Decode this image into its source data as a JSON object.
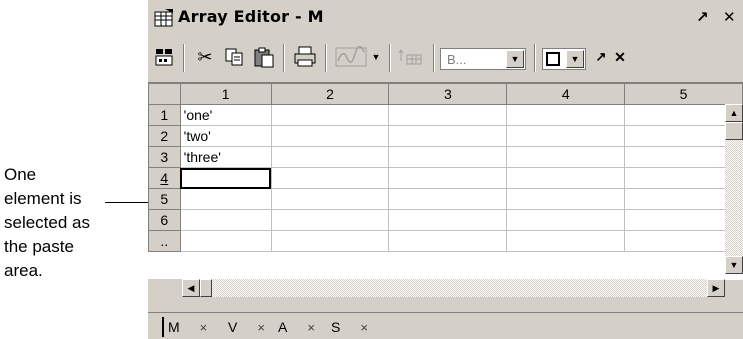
{
  "annotation": {
    "lines": [
      "One",
      "element is",
      "selected as",
      "the paste",
      "area."
    ]
  },
  "window": {
    "title": "Array Editor - M",
    "undock_label": "↗",
    "close_label": "✕"
  },
  "toolbar": {
    "icons": [
      "import-data-icon",
      "cut-icon",
      "copy-icon",
      "paste-icon",
      "print-icon",
      "plot-icon",
      "stack-icon"
    ],
    "base_combo_text": "B...",
    "layout_close": "✕",
    "layout_undock": "↗"
  },
  "grid": {
    "column_headers": [
      "1",
      "2",
      "3",
      "4",
      "5"
    ],
    "row_headers": [
      "1",
      "2",
      "3",
      "4",
      "5",
      "6",
      ".."
    ],
    "cells": [
      [
        "'one'",
        "",
        "",
        "",
        ""
      ],
      [
        "'two'",
        "",
        "",
        "",
        ""
      ],
      [
        "'three'",
        "",
        "",
        "",
        ""
      ],
      [
        "",
        "",
        "",
        "",
        ""
      ],
      [
        "",
        "",
        "",
        "",
        ""
      ],
      [
        "",
        "",
        "",
        "",
        ""
      ],
      [
        "",
        "",
        "",
        "",
        ""
      ]
    ],
    "selected_row": "4",
    "selected_column": "1"
  },
  "tabs": [
    {
      "label": "M",
      "close": "×"
    },
    {
      "label": "V",
      "close": "×"
    },
    {
      "label": "A",
      "close": "×"
    },
    {
      "label": "S",
      "close": "×"
    }
  ]
}
